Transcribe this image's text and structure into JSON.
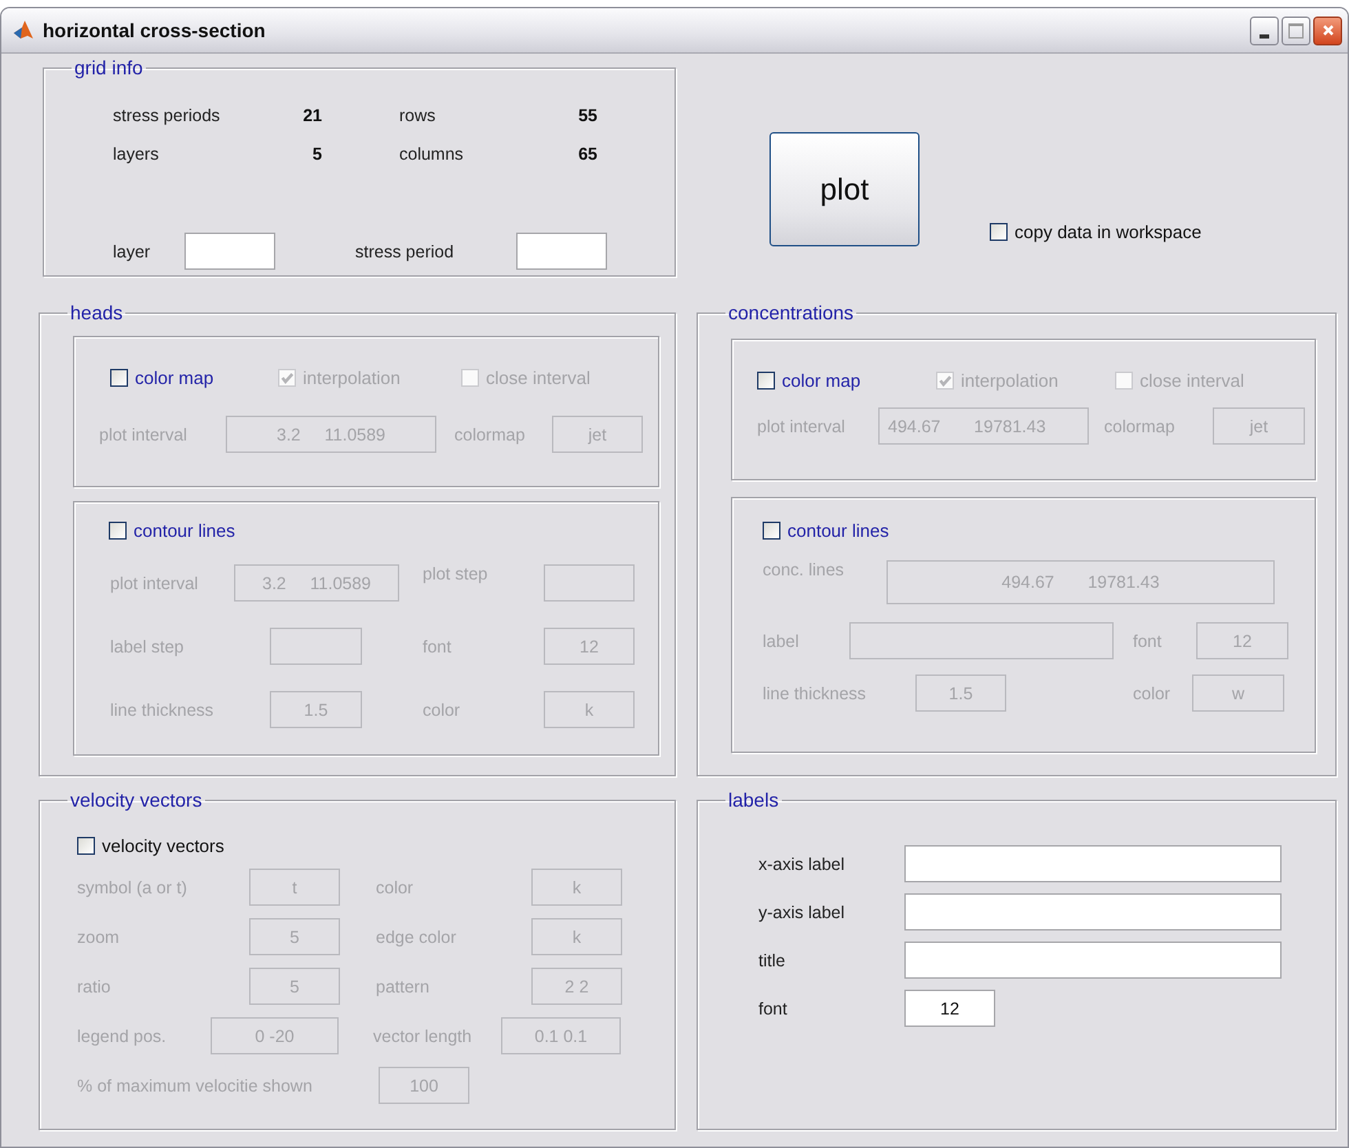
{
  "window": {
    "title": "horizontal cross-section"
  },
  "grid_info": {
    "title": "grid info",
    "stats": [
      {
        "label": "stress periods",
        "value": "21"
      },
      {
        "label": "rows",
        "value": "55"
      },
      {
        "label": "layers",
        "value": "5"
      },
      {
        "label": "columns",
        "value": "65"
      }
    ],
    "inputs": [
      {
        "label": "layer"
      },
      {
        "label": "stress period"
      }
    ]
  },
  "plot_button": "plot",
  "copy_option": {
    "label": "copy data in workspace",
    "checked": false
  },
  "heads": {
    "title": "heads",
    "color_map": {
      "checks": [
        {
          "label": "color map",
          "checked": false,
          "disabled": false
        },
        {
          "label": "interpolation",
          "checked": true,
          "disabled": true
        },
        {
          "label": "close interval",
          "checked": false,
          "disabled": true
        }
      ],
      "fields": [
        {
          "label": "plot interval",
          "value": "3.2     11.0589",
          "disabled": true
        },
        {
          "label": "colormap",
          "value": "jet",
          "disabled": true
        }
      ]
    },
    "contour": {
      "check": {
        "label": "contour lines",
        "checked": false,
        "disabled": false
      },
      "fields": [
        {
          "label": "plot interval",
          "value": "3.2     11.0589",
          "disabled": true
        },
        {
          "label": "plot step",
          "disabled": true
        },
        {
          "label": "label step",
          "disabled": true
        },
        {
          "label": "font",
          "value": "12",
          "disabled": true
        },
        {
          "label": "line thickness",
          "value": "1.5",
          "disabled": true
        },
        {
          "label": "color",
          "value": "k",
          "disabled": true
        }
      ]
    }
  },
  "concentrations": {
    "title": "concentrations",
    "color_map": {
      "checks": [
        {
          "label": "color map",
          "checked": false,
          "disabled": false
        },
        {
          "label": "interpolation",
          "checked": true,
          "disabled": true
        },
        {
          "label": "close interval",
          "checked": false,
          "disabled": true
        }
      ],
      "fields": [
        {
          "label": "plot interval",
          "value": "494.67       19781.43",
          "disabled": true
        },
        {
          "label": "colormap",
          "value": "jet",
          "disabled": true
        }
      ]
    },
    "contour": {
      "check": {
        "label": "contour lines",
        "checked": false,
        "disabled": false
      },
      "fields": [
        {
          "label": "conc. lines",
          "value": "494.67       19781.43",
          "disabled": true
        },
        {
          "label": "label",
          "disabled": true
        },
        {
          "label": "font",
          "value": "12",
          "disabled": true
        },
        {
          "label": "line thickness",
          "value": "1.5",
          "disabled": true
        },
        {
          "label": "color",
          "value": "w",
          "disabled": true
        }
      ]
    }
  },
  "velocity_vectors": {
    "title": "velocity vectors",
    "check": {
      "label": "velocity vectors",
      "checked": false,
      "disabled": false
    },
    "fields": [
      {
        "label": "symbol (a or t)",
        "value": "t",
        "disabled": true
      },
      {
        "label": "color",
        "value": "k",
        "disabled": true
      },
      {
        "label": "zoom",
        "value": "5",
        "disabled": true
      },
      {
        "label": "edge color",
        "value": "k",
        "disabled": true
      },
      {
        "label": "ratio",
        "value": "5",
        "disabled": true
      },
      {
        "label": "pattern",
        "value": "2 2",
        "disabled": true
      },
      {
        "label": "legend pos.",
        "value": "0 -20",
        "disabled": true
      },
      {
        "label": "vector length",
        "value": "0.1 0.1",
        "disabled": true
      },
      {
        "label": "% of maximum velocitie shown",
        "value": "100",
        "disabled": true
      }
    ]
  },
  "labels": {
    "title": "labels",
    "fields": [
      {
        "label": "x-axis label"
      },
      {
        "label": "y-axis label"
      },
      {
        "label": "title"
      },
      {
        "label": "font",
        "value": "12"
      }
    ]
  }
}
